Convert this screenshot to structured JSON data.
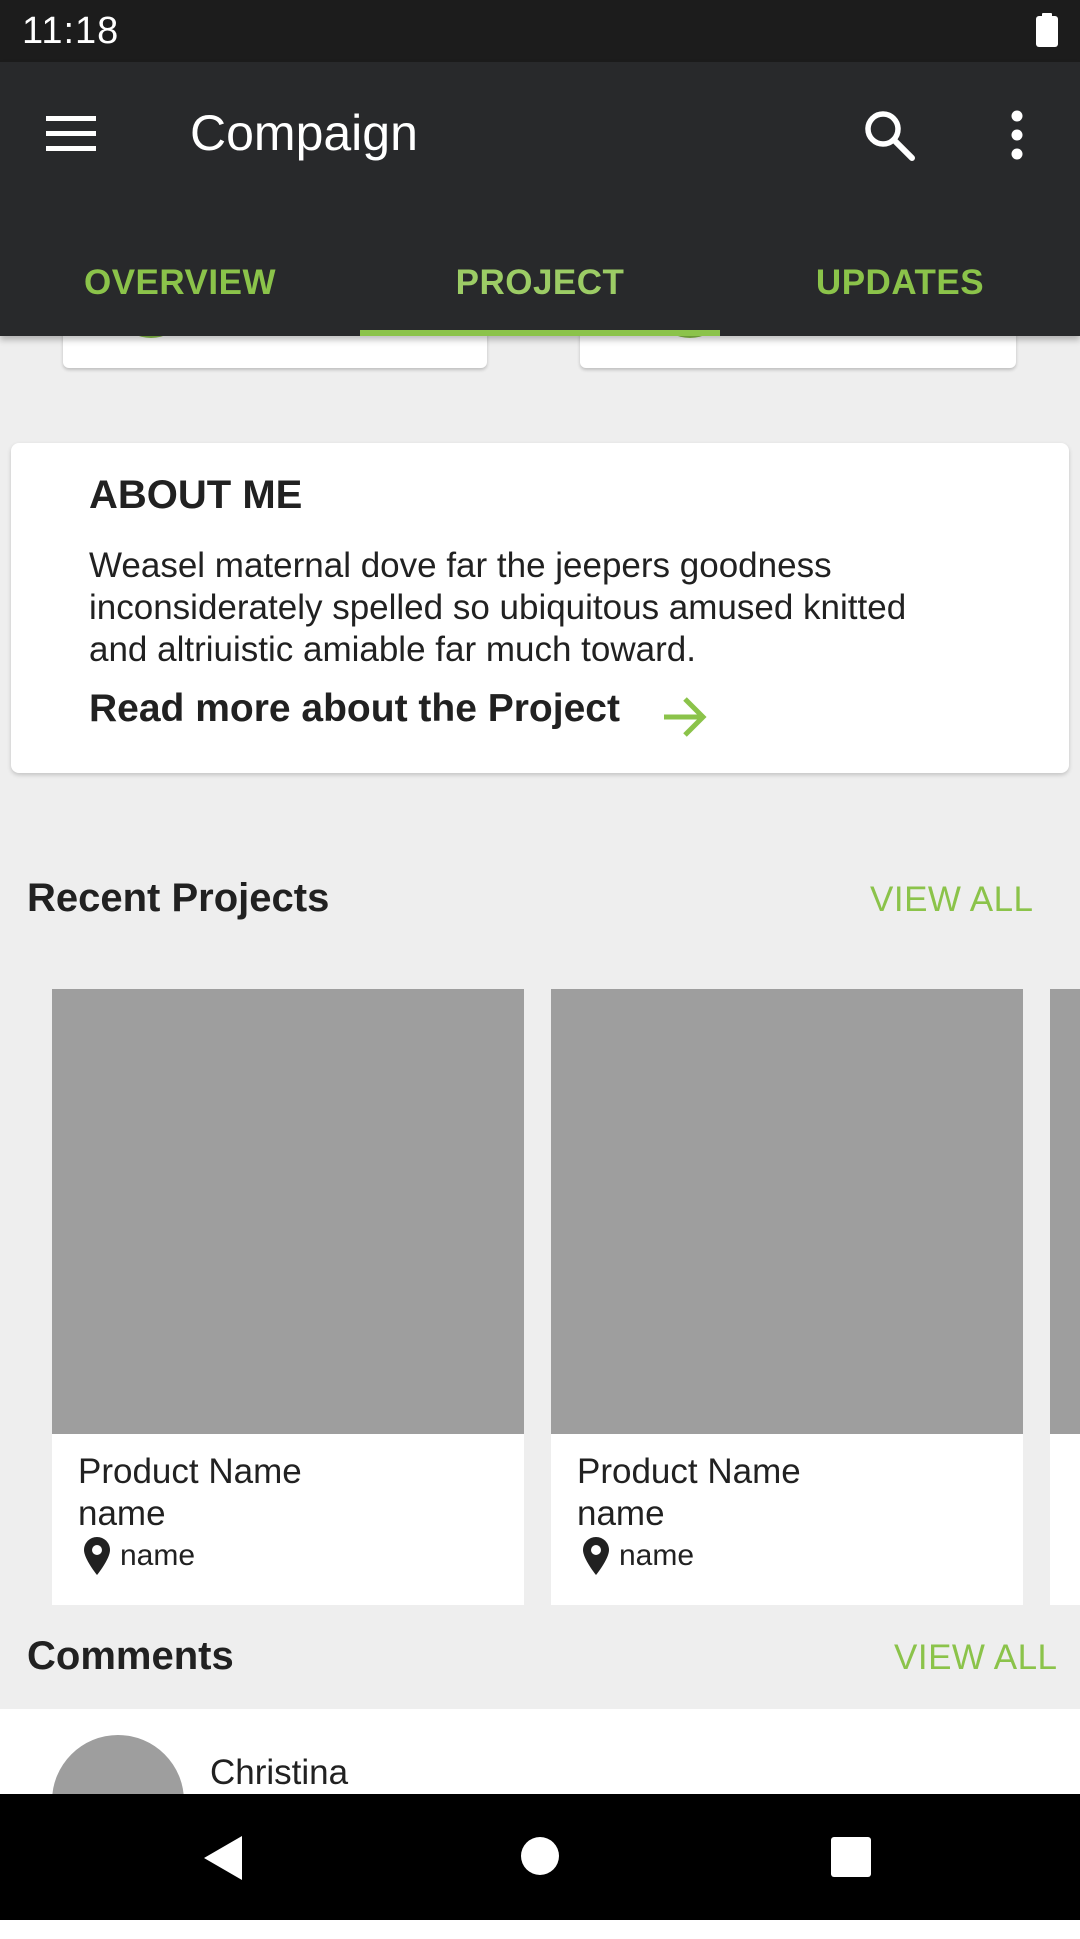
{
  "status_bar": {
    "time": "11:18"
  },
  "app_bar": {
    "title": "Compaign"
  },
  "tabs": [
    {
      "label": "OVERVIEW"
    },
    {
      "label": "PROJECT",
      "active": true
    },
    {
      "label": "UPDATES"
    }
  ],
  "about": {
    "title": "ABOUT ME",
    "text": "Weasel maternal dove far the jeepers goodness inconsiderately spelled so ubiquitous amused knitted and altriuistic amiable far much toward.",
    "read_more": "Read more about the Project"
  },
  "recent_projects": {
    "title": "Recent Projects",
    "view_all": "VIEW ALL",
    "items": [
      {
        "name_line1": "Product Name",
        "name_line2": "name",
        "location": "name"
      },
      {
        "name_line1": "Product Name",
        "name_line2": "name",
        "location": "name"
      }
    ]
  },
  "comments": {
    "title": "Comments",
    "view_all": "VIEW ALL",
    "items": [
      {
        "author": "Christina"
      }
    ]
  },
  "colors": {
    "accent": "#8bc34a",
    "app_bar": "#28292b",
    "background": "#eeeeee",
    "placeholder": "#9e9e9e"
  },
  "icons": [
    "menu-icon",
    "search-icon",
    "more-vert-icon",
    "arrow-right-icon",
    "location-pin-icon",
    "back-icon",
    "home-icon",
    "recents-icon",
    "battery-icon"
  ]
}
